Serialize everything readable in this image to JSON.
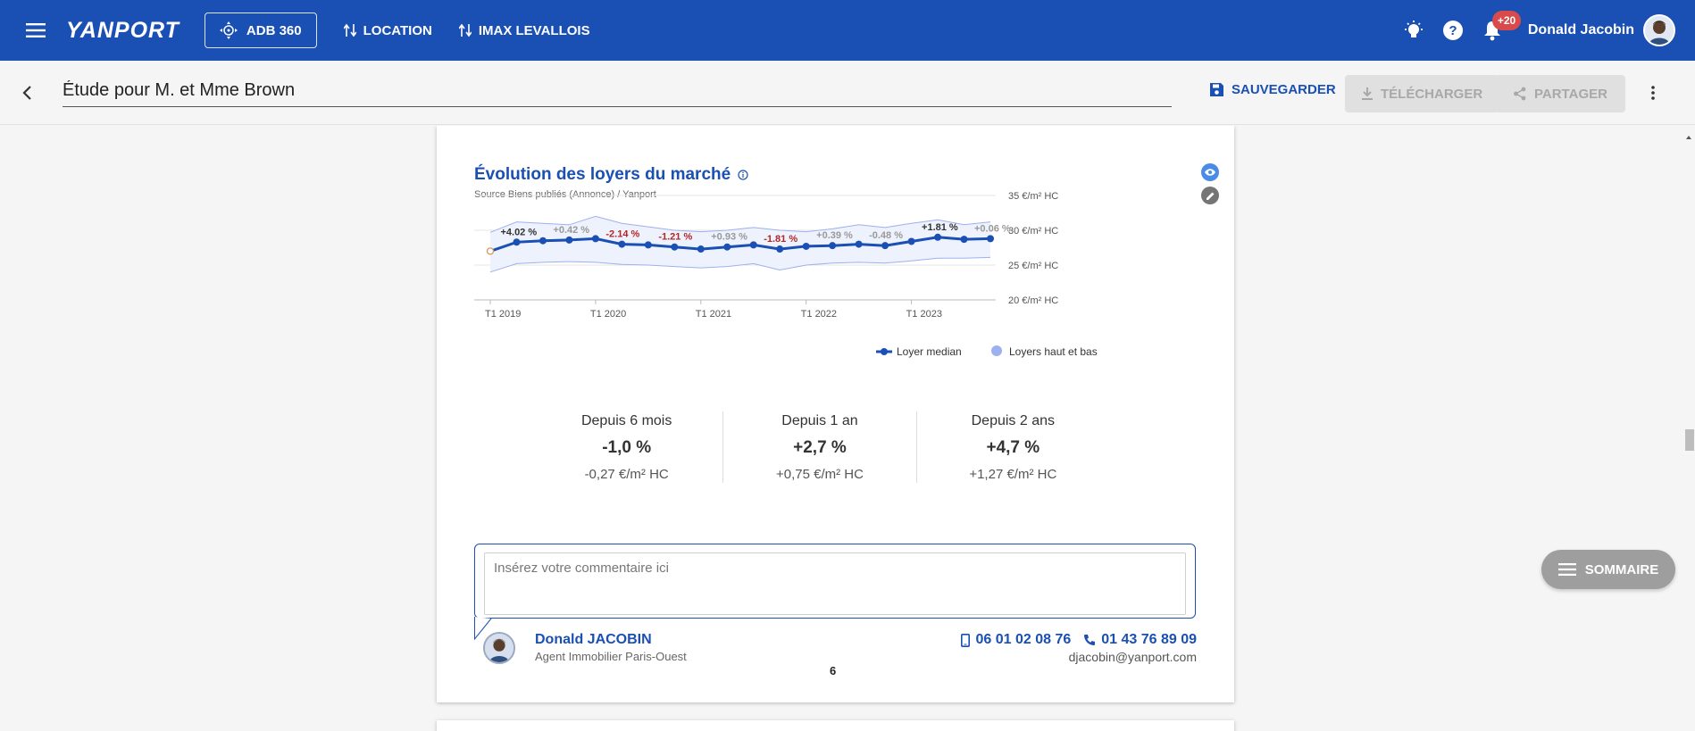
{
  "topbar": {
    "brand": "YANPORT",
    "adb_label": "ADB 360",
    "nav": [
      {
        "label": "LOCATION"
      },
      {
        "label": "IMAX LEVALLOIS"
      }
    ],
    "notifications_badge": "+20",
    "user_name": "Donald Jacobin"
  },
  "subbar": {
    "study_title": "Étude pour M. et Mme Brown",
    "save_label": "SAUVEGARDER",
    "download_label": "TÉLÉCHARGER",
    "share_label": "PARTAGER"
  },
  "section": {
    "title": "Évolution des loyers du marché",
    "source": "Source Biens publiés (Annonce) / Yanport"
  },
  "chart_data": {
    "type": "line",
    "title": "Évolution des loyers du marché",
    "x": [
      "T1 2019",
      "T2 2019",
      "T3 2019",
      "T4 2019",
      "T1 2020",
      "T2 2020",
      "T3 2020",
      "T4 2020",
      "T1 2021",
      "T2 2021",
      "T3 2021",
      "T4 2021",
      "T1 2022",
      "T2 2022",
      "T3 2022",
      "T4 2022",
      "T1 2023",
      "T2 2023",
      "T3 2023",
      "T4 2023"
    ],
    "x_tick_labels": [
      "T1 2019",
      "T1 2020",
      "T1 2021",
      "T1 2022",
      "T1 2023"
    ],
    "y_tick_labels": [
      "35 €/m² HC",
      "30 €/m² HC",
      "25 €/m² HC",
      "20 €/m² HC"
    ],
    "ylim": [
      20,
      35
    ],
    "series": [
      {
        "name": "Loyer median",
        "color": "#1a4fb4",
        "values": [
          27.0,
          28.3,
          28.5,
          28.6,
          28.8,
          28.0,
          27.9,
          27.6,
          27.3,
          27.6,
          27.9,
          27.3,
          27.7,
          27.8,
          28.0,
          27.8,
          28.4,
          29.0,
          28.7,
          28.8
        ]
      },
      {
        "name": "Loyers haut et bas",
        "color": "#9db0ef",
        "high": [
          29.7,
          31.2,
          31.0,
          30.8,
          32.0,
          31.0,
          30.5,
          30.0,
          29.8,
          30.0,
          30.4,
          30.0,
          29.8,
          30.2,
          30.8,
          30.4,
          31.0,
          31.5,
          30.8,
          31.2
        ],
        "low": [
          24.0,
          25.2,
          25.4,
          25.5,
          25.4,
          25.1,
          25.0,
          24.8,
          24.6,
          24.8,
          25.2,
          24.3,
          25.0,
          25.3,
          25.4,
          25.3,
          25.6,
          26.0,
          26.0,
          26.1
        ]
      }
    ],
    "annotations": [
      {
        "index": 1,
        "text": "+4.02 %",
        "color": "#333333"
      },
      {
        "index": 3,
        "text": "+0.42 %",
        "color": "#999999"
      },
      {
        "index": 5,
        "text": "-2.14 %",
        "color": "#b32626"
      },
      {
        "index": 7,
        "text": "-1.21 %",
        "color": "#b32626"
      },
      {
        "index": 9,
        "text": "+0.93 %",
        "color": "#999999"
      },
      {
        "index": 11,
        "text": "-1.81 %",
        "color": "#b32626"
      },
      {
        "index": 13,
        "text": "+0.39 %",
        "color": "#999999"
      },
      {
        "index": 15,
        "text": "-0.48 %",
        "color": "#999999"
      },
      {
        "index": 17,
        "text": "+1.81 %",
        "color": "#333333"
      },
      {
        "index": 19,
        "text": "+0.06 %",
        "color": "#999999"
      }
    ],
    "legend": [
      "Loyer median",
      "Loyers haut et bas"
    ],
    "legend_position": "bottom-right",
    "grid": true
  },
  "stats": [
    {
      "period": "Depuis 6 mois",
      "pct": "-1,0 %",
      "abs": "-0,27 €/m² HC"
    },
    {
      "period": "Depuis 1 an",
      "pct": "+2,7 %",
      "abs": "+0,75 €/m² HC"
    },
    {
      "period": "Depuis 2 ans",
      "pct": "+4,7 %",
      "abs": "+1,27 €/m² HC"
    }
  ],
  "comment": {
    "placeholder": "Insérez votre commentaire ici"
  },
  "agent": {
    "name": "Donald JACOBIN",
    "role": "Agent Immobilier Paris-Ouest",
    "mobile": "06 01 02 08 76",
    "phone": "01 43 76 89 09",
    "email": "djacobin@yanport.com"
  },
  "page_number": "6",
  "summary_label": "SOMMAIRE",
  "colors": {
    "primary": "#1a4fb4",
    "negative": "#b32626",
    "band": "#9db0ef"
  }
}
